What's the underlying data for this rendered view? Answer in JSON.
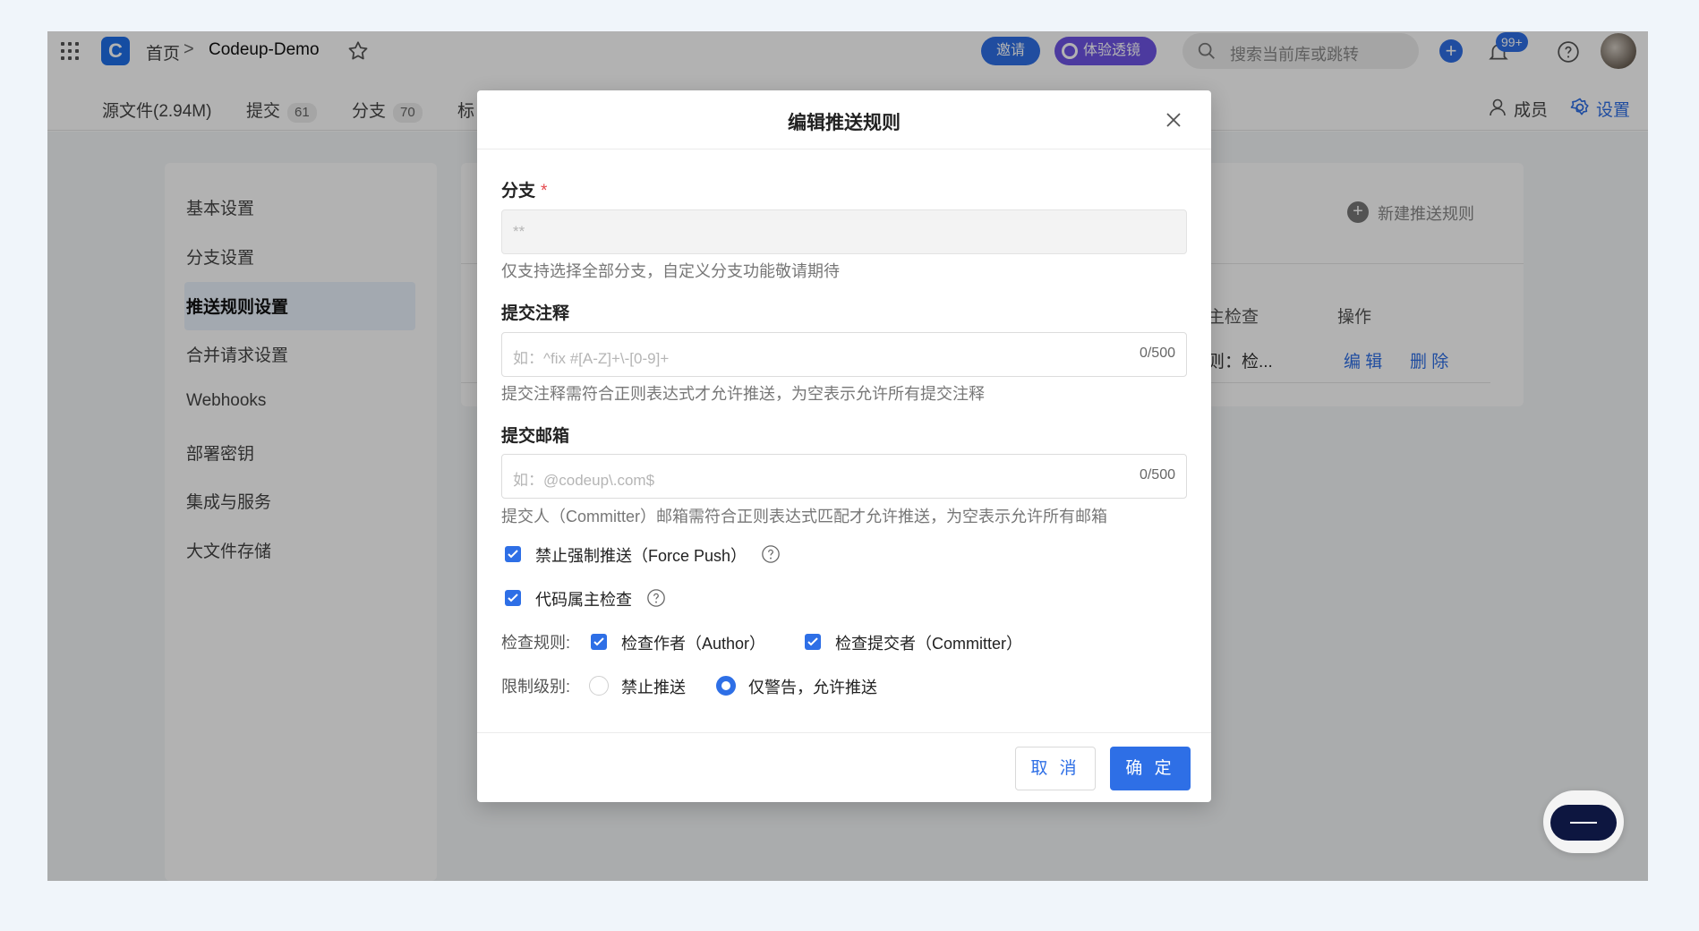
{
  "topbar": {
    "home": "首页",
    "separator": ">",
    "repo": "Codeup-Demo",
    "invite": "邀请",
    "lens": "体验透镜",
    "search_placeholder": "搜索当前库或跳转",
    "notif_badge": "99+"
  },
  "subnav": {
    "tabs": [
      {
        "label": "源文件(2.94M)"
      },
      {
        "label": "提交",
        "count": "61"
      },
      {
        "label": "分支",
        "count": "70"
      },
      {
        "label": "标"
      }
    ],
    "members": "成员",
    "settings": "设置"
  },
  "sidebar": {
    "items": [
      "基本设置",
      "分支设置",
      "推送规则设置",
      "合并请求设置",
      "Webhooks",
      "部署密钥",
      "集成与服务",
      "大文件存储"
    ]
  },
  "content": {
    "new_rule": "新建推送规则",
    "col_check": "主检查",
    "col_ops": "操作",
    "row_check": "则：检...",
    "edit": "编 辑",
    "delete": "删 除"
  },
  "modal": {
    "title": "编辑推送规则",
    "branch_label": "分支",
    "required_mark": "*",
    "branch_value": "**",
    "branch_help": "仅支持选择全部分支，自定义分支功能敬请期待",
    "commit_msg_label": "提交注释",
    "commit_msg_placeholder": "如：^fix #[A-Z]+\\-[0-9]+",
    "commit_msg_counter": "0/500",
    "commit_msg_help": "提交注释需符合正则表达式才允许推送，为空表示允许所有提交注释",
    "commit_email_label": "提交邮箱",
    "commit_email_placeholder": "如：@codeup\\.com$",
    "commit_email_counter": "0/500",
    "commit_email_help": "提交人（Committer）邮箱需符合正则表达式匹配才允许推送，为空表示允许所有邮箱",
    "force_push": "禁止强制推送（Force Push）",
    "code_owner": "代码属主检查",
    "check_rule_label": "检查规则:",
    "check_author": "检查作者（Author）",
    "check_committer": "检查提交者（Committer）",
    "restrict_label": "限制级别:",
    "restrict_block": "禁止推送",
    "restrict_warn": "仅警告，允许推送",
    "cancel": "取 消",
    "ok": "确 定"
  },
  "colors": {
    "accent": "#2e6fe6",
    "required": "#e5484d"
  }
}
